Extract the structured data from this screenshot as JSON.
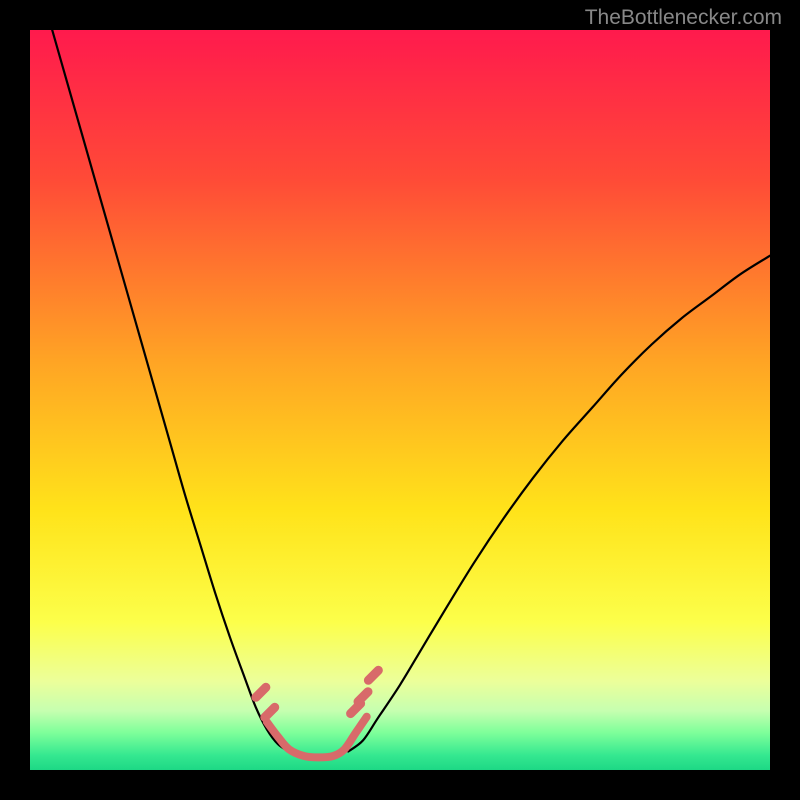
{
  "watermark": "TheBottlenecker.com",
  "chart_data": {
    "type": "line",
    "title": "",
    "xlabel": "",
    "ylabel": "",
    "xlim": [
      0,
      100
    ],
    "ylim": [
      0,
      100
    ],
    "background": {
      "gradient_stops": [
        {
          "offset": 0,
          "color": "#ff1a4d"
        },
        {
          "offset": 20,
          "color": "#ff4a37"
        },
        {
          "offset": 45,
          "color": "#ffa524"
        },
        {
          "offset": 65,
          "color": "#ffe31a"
        },
        {
          "offset": 80,
          "color": "#fcff4a"
        },
        {
          "offset": 88,
          "color": "#ecff9a"
        },
        {
          "offset": 92,
          "color": "#c6ffb0"
        },
        {
          "offset": 95,
          "color": "#7dff9a"
        },
        {
          "offset": 98,
          "color": "#35e890"
        },
        {
          "offset": 100,
          "color": "#1dd885"
        }
      ]
    },
    "series": [
      {
        "name": "curve-left",
        "stroke": "#000000",
        "stroke_width": 2.2,
        "x": [
          3,
          5,
          7,
          9,
          11,
          13,
          15,
          17,
          19,
          21,
          23,
          25,
          27,
          29,
          30.5,
          32,
          33.5,
          35
        ],
        "y": [
          100,
          93,
          86,
          79,
          72,
          65,
          58,
          51,
          44,
          37,
          30.5,
          24,
          18,
          12.5,
          8.5,
          5.5,
          3.5,
          2.5
        ]
      },
      {
        "name": "curve-right",
        "stroke": "#000000",
        "stroke_width": 2.2,
        "x": [
          43,
          45,
          47,
          50,
          53,
          56,
          60,
          64,
          68,
          72,
          76,
          80,
          84,
          88,
          92,
          96,
          100
        ],
        "y": [
          2.5,
          4,
          7,
          11.5,
          16.5,
          21.5,
          28,
          34,
          39.5,
          44.5,
          49,
          53.5,
          57.5,
          61,
          64,
          67,
          69.5
        ]
      },
      {
        "name": "bottom-valley",
        "stroke": "#d86a6a",
        "stroke_width": 8,
        "x": [
          32,
          33.5,
          35,
          37,
          39,
          41,
          42.5,
          44,
          45.5
        ],
        "y": [
          6.5,
          4.5,
          2.8,
          1.9,
          1.7,
          1.9,
          2.8,
          5.0,
          7.2
        ]
      }
    ],
    "markers": [
      {
        "name": "dash-left-upper",
        "x": 31.2,
        "y": 10.5,
        "color": "#d86a6a"
      },
      {
        "name": "dash-left-lower",
        "x": 32.4,
        "y": 7.8,
        "color": "#d86a6a"
      },
      {
        "name": "dash-right-inner-1",
        "x": 44.0,
        "y": 8.3,
        "color": "#d86a6a"
      },
      {
        "name": "dash-right-inner-2",
        "x": 45.0,
        "y": 9.9,
        "color": "#d86a6a"
      },
      {
        "name": "dash-right-outer",
        "x": 46.4,
        "y": 12.8,
        "color": "#d86a6a"
      }
    ]
  }
}
